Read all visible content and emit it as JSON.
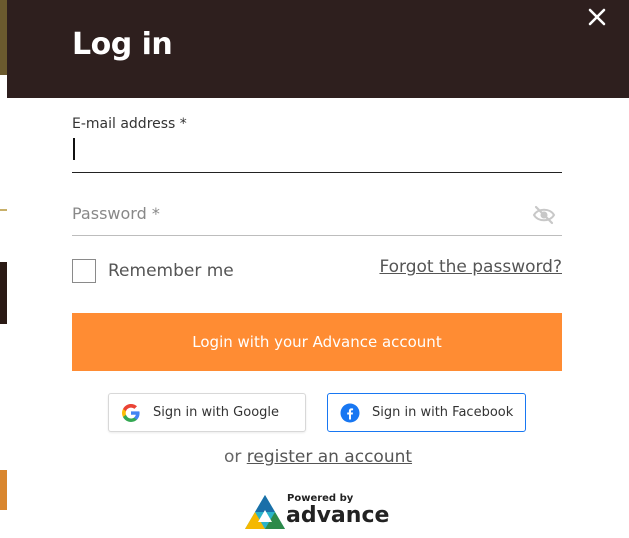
{
  "modal": {
    "title": "Log in",
    "close_icon": "close-icon"
  },
  "form": {
    "email_label": "E-mail address *",
    "email_value": "",
    "password_placeholder": "Password *",
    "password_toggle_icon": "eye-slash-icon",
    "remember_label": "Remember me",
    "remember_checked": false,
    "forgot_link": "Forgot the password?",
    "login_button": "Login with your Advance account"
  },
  "social": {
    "google_label": "Sign in with Google",
    "google_icon": "google-icon",
    "facebook_label": "Sign in with Facebook",
    "facebook_icon": "facebook-icon"
  },
  "register": {
    "prefix": "or",
    "link": "register an account"
  },
  "branding": {
    "powered_by": "Powered by",
    "name": "advance"
  },
  "colors": {
    "header_bg": "#2e1f1e",
    "accent": "#ff8c33",
    "facebook_blue": "#1877f2"
  }
}
